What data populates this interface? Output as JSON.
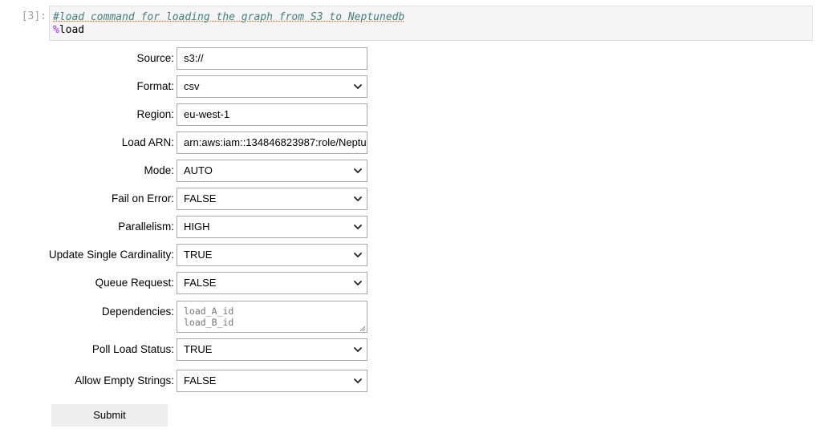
{
  "cell": {
    "prompt": "[3]:",
    "comment": "#load command for loading the graph from S3 to Neptunedb",
    "magic_pct": "%",
    "magic_cmd": "load"
  },
  "form": {
    "source": {
      "label": "Source:",
      "value": "s3://"
    },
    "format": {
      "label": "Format:",
      "value": "csv"
    },
    "region": {
      "label": "Region:",
      "value": "eu-west-1"
    },
    "load_arn": {
      "label": "Load ARN:",
      "value": "arn:aws:iam::134846823987:role/Neptu"
    },
    "mode": {
      "label": "Mode:",
      "value": "AUTO"
    },
    "fail_on_error": {
      "label": "Fail on Error:",
      "value": "FALSE"
    },
    "parallelism": {
      "label": "Parallelism:",
      "value": "HIGH"
    },
    "update_single_cardinality": {
      "label": "Update Single Cardinality:",
      "value": "TRUE"
    },
    "queue_request": {
      "label": "Queue Request:",
      "value": "FALSE"
    },
    "dependencies": {
      "label": "Dependencies:",
      "placeholder": "load_A_id\nload_B_id"
    },
    "poll_load_status": {
      "label": "Poll Load Status:",
      "value": "TRUE"
    },
    "allow_empty_strings": {
      "label": "Allow Empty Strings:",
      "value": "FALSE"
    }
  },
  "submit_label": "Submit",
  "icons": {
    "dropdown": "chevron-down-icon",
    "resize": "resize-grip-icon"
  }
}
